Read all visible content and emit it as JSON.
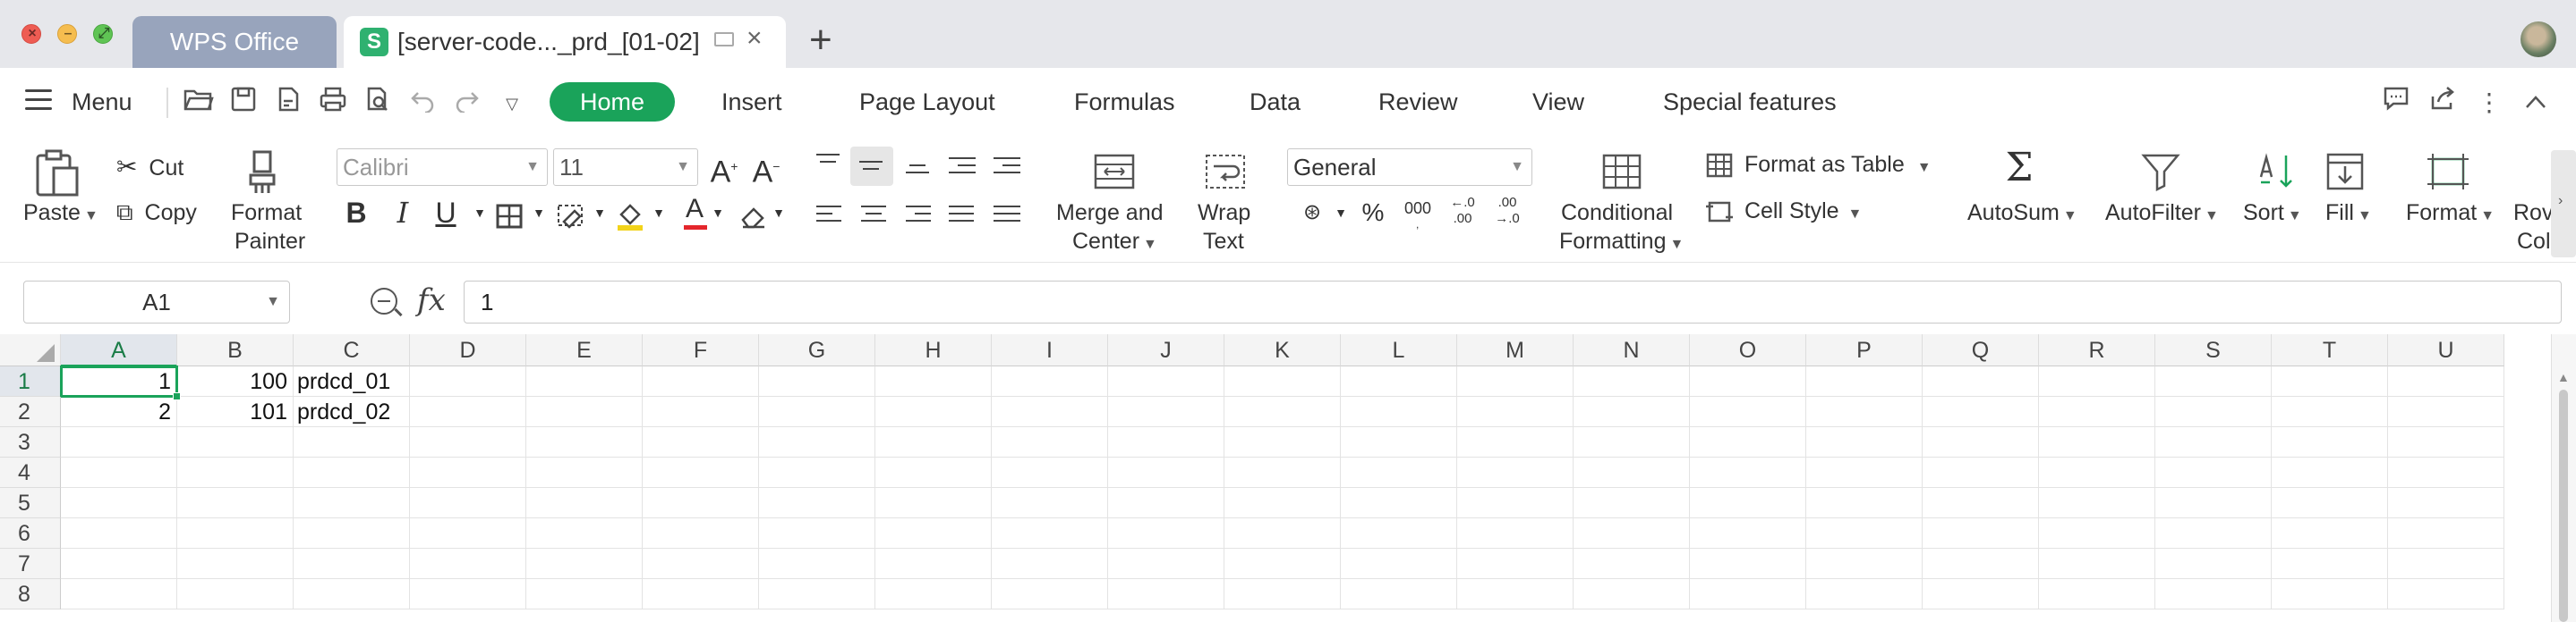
{
  "window": {
    "tabs": [
      {
        "label": "WPS Office"
      },
      {
        "label": "[server-code..._prd_[01-02]"
      }
    ]
  },
  "menubar": {
    "menu_label": "Menu",
    "tabs": [
      "Home",
      "Insert",
      "Page Layout",
      "Formulas",
      "Data",
      "Review",
      "View",
      "Special features"
    ]
  },
  "ribbon": {
    "paste": "Paste",
    "cut": "Cut",
    "copy": "Copy",
    "format_painter_1": "Format",
    "format_painter_2": "Painter",
    "font_name": "Calibri",
    "font_size": "11",
    "merge_1": "Merge and",
    "merge_2": "Center",
    "wrap_1": "Wrap",
    "wrap_2": "Text",
    "number_format": "General",
    "conditional_1": "Conditional",
    "conditional_2": "Formatting",
    "format_as_table": "Format as Table",
    "cell_style": "Cell Style",
    "autosum": "AutoSum",
    "autofilter": "AutoFilter",
    "sort": "Sort",
    "fill": "Fill",
    "format": "Format",
    "rows_cols_1": "Rov",
    "rows_cols_2": "Col"
  },
  "formula_bar": {
    "name_box": "A1",
    "fx": "fx",
    "value": "1"
  },
  "sheet": {
    "columns": [
      "A",
      "B",
      "C",
      "D",
      "E",
      "F",
      "G",
      "H",
      "I",
      "J",
      "K",
      "L",
      "M",
      "N",
      "O",
      "P",
      "Q",
      "R",
      "S",
      "T",
      "U"
    ],
    "rows": [
      "1",
      "2",
      "3",
      "4",
      "5",
      "6",
      "7",
      "8"
    ],
    "data": [
      {
        "A": "1",
        "B": "100",
        "C": "prdcd_01"
      },
      {
        "A": "2",
        "B": "101",
        "C": "prdcd_02"
      }
    ],
    "active_cell": "A1"
  },
  "colors": {
    "accent": "#1aa35a",
    "tab_inactive": "#98a4bc",
    "titlebar": "#e6e7eb"
  }
}
